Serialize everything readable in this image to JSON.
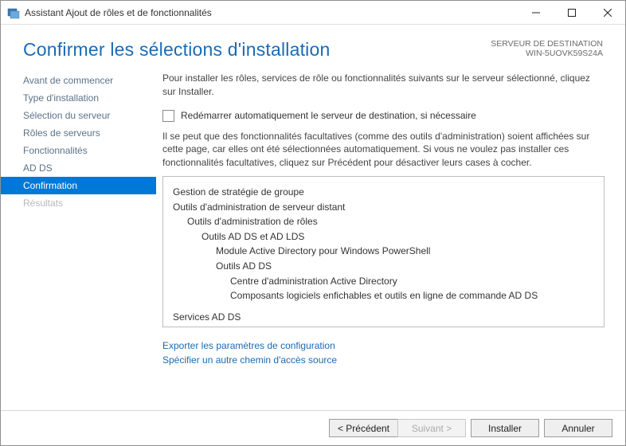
{
  "titlebar": {
    "title": "Assistant Ajout de rôles et de fonctionnalités"
  },
  "header": {
    "page_title": "Confirmer les sélections d'installation",
    "dest_label": "SERVEUR DE DESTINATION",
    "dest_server": "WIN-5UOVK59S24A"
  },
  "sidebar": {
    "steps": [
      {
        "label": "Avant de commencer",
        "state": "done"
      },
      {
        "label": "Type d'installation",
        "state": "done"
      },
      {
        "label": "Sélection du serveur",
        "state": "done"
      },
      {
        "label": "Rôles de serveurs",
        "state": "done"
      },
      {
        "label": "Fonctionnalités",
        "state": "done"
      },
      {
        "label": "AD DS",
        "state": "done"
      },
      {
        "label": "Confirmation",
        "state": "active"
      },
      {
        "label": "Résultats",
        "state": "disabled"
      }
    ]
  },
  "main": {
    "intro": "Pour installer les rôles, services de rôle ou fonctionnalités suivants sur le serveur sélectionné, cliquez sur Installer.",
    "restart_label": "Redémarrer automatiquement le serveur de destination, si nécessaire",
    "note": "Il se peut que des fonctionnalités facultatives (comme des outils d'administration) soient affichées sur cette page, car elles ont été sélectionnées automatiquement. Si vous ne voulez pas installer ces fonctionnalités facultatives, cliquez sur Précédent pour désactiver leurs cases à cocher.",
    "features": [
      {
        "label": "Gestion de stratégie de groupe",
        "indent": 0
      },
      {
        "label": "Outils d'administration de serveur distant",
        "indent": 0
      },
      {
        "label": "Outils d'administration de rôles",
        "indent": 1
      },
      {
        "label": "Outils AD DS et AD LDS",
        "indent": 2
      },
      {
        "label": "Module Active Directory pour Windows PowerShell",
        "indent": 3
      },
      {
        "label": "Outils AD DS",
        "indent": 3
      },
      {
        "label": "Centre d'administration Active Directory",
        "indent": 4
      },
      {
        "label": "Composants logiciels enfichables et outils en ligne de commande AD DS",
        "indent": 4
      },
      {
        "label": "Services AD DS",
        "indent": 0
      }
    ],
    "links": {
      "export": "Exporter les paramètres de configuration",
      "alt_path": "Spécifier un autre chemin d'accès source"
    }
  },
  "footer": {
    "previous": "< Précédent",
    "next": "Suivant >",
    "install": "Installer",
    "cancel": "Annuler"
  }
}
